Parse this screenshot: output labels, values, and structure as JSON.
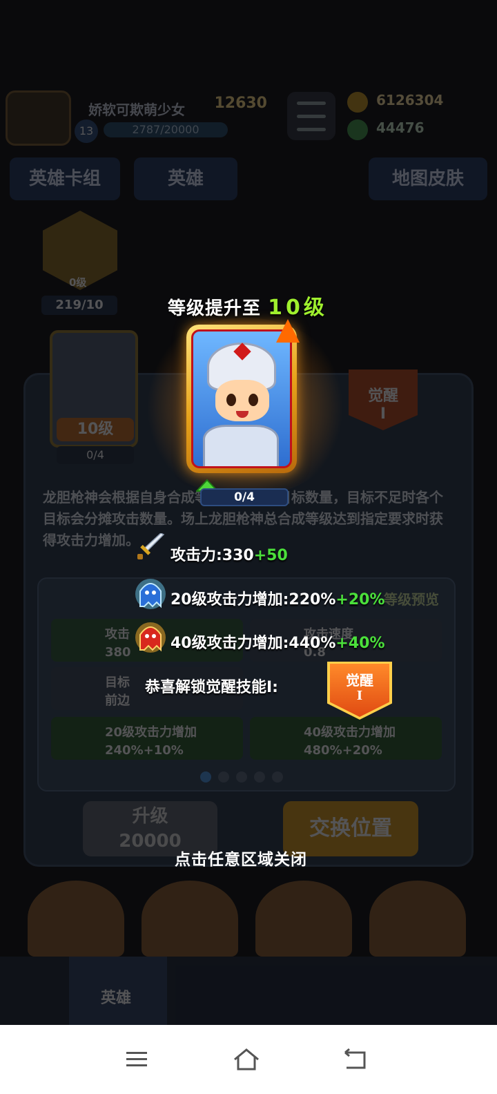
{
  "background": {
    "player_name": "娇软可欺萌少女",
    "player_level": "13",
    "player_exp": "2787/20000",
    "trophies": "12630",
    "gold": "6126304",
    "gems": "44476",
    "tabs": [
      "英雄卡组",
      "英雄",
      "地图皮肤"
    ],
    "weapon_level": "0级",
    "weapon_progress": "219/10",
    "hero_level": "10级",
    "hero_cards": "0/4",
    "awaken_badge_line1": "觉醒",
    "awaken_badge_line2": "I",
    "description": "龙胆枪神会根据自身合成等级增加攻击目标数量，目标不足时各个目标会分摊攻击数量。场上龙胆枪神总合成等级达到指定要求时获得攻击力增加。",
    "stat_attack_label": "攻击",
    "stat_attack_value": "380",
    "stat_speed_label": "攻击速度",
    "stat_speed_value": "0.8",
    "stat_target_label": "目标",
    "stat_target_value": "前边",
    "stat_lv20_label": "20级攻击力增加",
    "stat_lv20_value": "240%+10%",
    "stat_lv40_label": "40级攻击力增加",
    "stat_lv40_value": "480%+20%",
    "preview_link": "等级预览",
    "upgrade_label": "升级",
    "upgrade_cost": "20000",
    "swap_label": "交换位置",
    "nav_active_label": "英雄"
  },
  "popup": {
    "title_prefix": "等级提升至",
    "title_level": "10级",
    "card_progress": "0/4",
    "attack_label": "攻击力:330",
    "attack_bonus": "+50",
    "lv20_label": "20级攻击力增加:220%",
    "lv20_bonus": "+20%",
    "lv40_label": "40级攻击力增加:440%",
    "lv40_bonus": "+40%",
    "unlock_label": "恭喜解锁觉醒技能I:",
    "badge_line1": "觉醒",
    "badge_line2": "I",
    "close_hint": "点击任意区域关闭"
  },
  "colors": {
    "bonus_green": "#4be03b",
    "level_green": "#9ff02e",
    "badge_orange": "#e04a12"
  },
  "icons": [
    "sword-icon",
    "blue-ghost-icon",
    "red-ghost-icon",
    "up-arrow-icon",
    "menu-icon",
    "home-icon",
    "back-icon"
  ]
}
